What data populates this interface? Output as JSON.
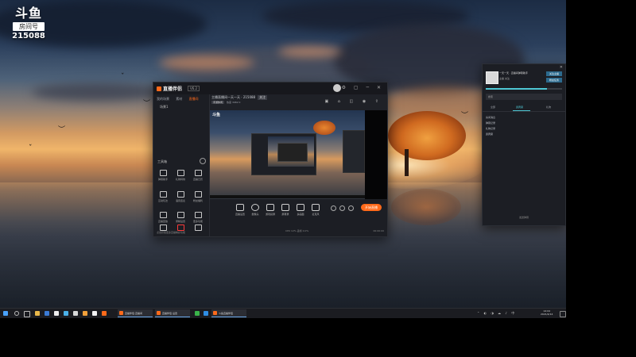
{
  "overlay_logo": {
    "brand": "斗鱼",
    "room_label": "房间号",
    "room_number": "215088"
  },
  "app": {
    "brand": "直播伴侣",
    "version_badge": "V6.2",
    "sidebar_tabs": [
      "我的场景",
      "素材",
      "直播间"
    ],
    "scene_name": "场景1",
    "tools_title": "工具箱",
    "tools": [
      {
        "label": "弹幕助手",
        "icon": "barrage-icon"
      },
      {
        "label": "礼物特效",
        "icon": "gift-icon"
      },
      {
        "label": "直播日历",
        "icon": "calendar-icon"
      },
      {
        "label": "互动玩法",
        "icon": "game-icon"
      },
      {
        "label": "语音连麦",
        "icon": "mic-icon"
      },
      {
        "label": "粉丝福利",
        "icon": "fans-icon"
      },
      {
        "label": "直播回放",
        "icon": "replay-icon"
      },
      {
        "label": "录制设置",
        "icon": "record-icon"
      },
      {
        "label": "更多功能",
        "icon": "more-icon"
      },
      {
        "label": "上麦",
        "icon": "mic-up-icon"
      },
      {
        "label": "分享",
        "icon": "share-icon"
      },
      {
        "label": "设置",
        "icon": "settings-icon"
      }
    ],
    "sidebar_footer": "点击获取更多直播精彩功能",
    "room_title": "主播直播间一天一天 · 215088",
    "follow_label": "关注",
    "category": "手游休闲",
    "meta_text": "热度 3982   0",
    "controls": [
      {
        "label": "直播设置",
        "icon": "monitor-icon"
      },
      {
        "label": "摄像头",
        "icon": "camera-icon"
      },
      {
        "label": "游戏投屏",
        "icon": "cast-icon"
      },
      {
        "label": "屏幕录",
        "icon": "screen-icon"
      },
      {
        "label": "多画面",
        "icon": "layers-icon"
      },
      {
        "label": "麦克风",
        "icon": "speaker-icon"
      }
    ],
    "go_live_label": "开始直播",
    "status_left": "CPU 12%   丢帧 0.0%",
    "status_right": "00:00:00"
  },
  "chat": {
    "anchor_name": "一天一天 · 直播间弹幕助手",
    "anchor_small": "主播   关注",
    "follow_btn": "关注主播",
    "task_btn": "粉丝任务",
    "search_placeholder": "搜索",
    "tabs": [
      "全部",
      "贵宾席",
      "礼物"
    ],
    "list": [
      "房间消息",
      "弹幕记录",
      "礼物记录",
      "贵宾席"
    ],
    "footer": "发送弹幕"
  },
  "taskbar": {
    "items": [
      "直播伴侣·直播间",
      "直播伴侣·设置",
      "斗鱼直播伴侣"
    ],
    "clock_time": "14:04",
    "clock_date": "2021/4/14"
  }
}
